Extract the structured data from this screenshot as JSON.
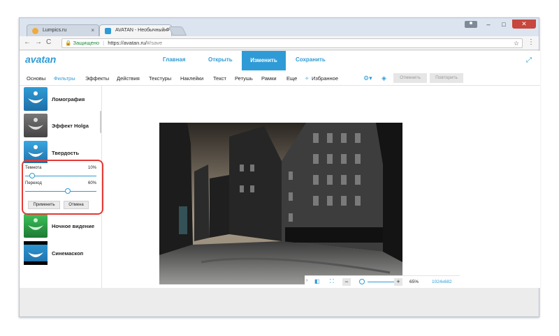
{
  "browser": {
    "tabs": [
      {
        "title": "Lumpics.ru",
        "favicon_color": "#f2a93b"
      },
      {
        "title": "AVATAN - Необычный Ф",
        "favicon_color": "#2e9bd6"
      }
    ],
    "close_glyph": "×",
    "address": {
      "secure_label": "Защищено",
      "url_host": "https://avatan.ru/",
      "url_path": "#/save"
    },
    "window_buttons": {
      "minimize": "–",
      "maximize": "□",
      "close": "✕"
    }
  },
  "app": {
    "logo_text": "avatan",
    "top_nav": [
      {
        "label": "Главная",
        "active": false
      },
      {
        "label": "Открыть",
        "active": false
      },
      {
        "label": "Изменить",
        "active": true
      },
      {
        "label": "Сохранить",
        "active": false
      }
    ],
    "toolbar": {
      "items": [
        {
          "label": "Основы",
          "active": false
        },
        {
          "label": "Фильтры",
          "active": true
        },
        {
          "label": "Эффекты",
          "active": false
        },
        {
          "label": "Действия",
          "active": false
        },
        {
          "label": "Текстуры",
          "active": false
        },
        {
          "label": "Наклейки",
          "active": false
        },
        {
          "label": "Текст",
          "active": false
        },
        {
          "label": "Ретушь",
          "active": false
        },
        {
          "label": "Рамки",
          "active": false
        },
        {
          "label": "Еще",
          "active": false
        },
        {
          "label": "Избранное",
          "active": false
        }
      ],
      "undo_label": "Отменить",
      "redo_label": "Повторить"
    },
    "filters": [
      {
        "name": "Ломография",
        "thumb_color": "#2e9bd6"
      },
      {
        "name": "Эффект Holga",
        "thumb_color": "#666666"
      },
      {
        "name": "Твердость",
        "thumb_color": "#2e9bd6"
      },
      {
        "name": "Ночное видение",
        "thumb_color": "#2fa84a"
      },
      {
        "name": "Синемаскоп",
        "thumb_color": "#2e9bd6"
      }
    ],
    "settings_panel": {
      "darkness_label": "Темнота",
      "darkness_value": "10%",
      "darkness_level": 0.1,
      "transition_label": "Переход",
      "transition_value": "60%",
      "transition_level": 0.6,
      "apply_label": "Применить",
      "cancel_label": "Отмена"
    },
    "bottom_bar": {
      "zoom_value": "65%",
      "dimensions": "1024x682",
      "minus": "−",
      "plus": "+"
    },
    "colors": {
      "accent": "#2e9bd6",
      "highlight": "#e53935"
    }
  }
}
